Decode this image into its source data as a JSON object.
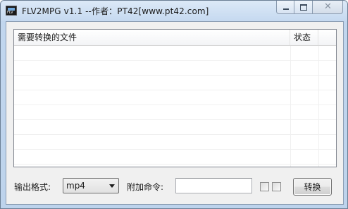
{
  "window": {
    "title": "FLV2MPG v1.1 --作者：PT42[www.pt42.com]"
  },
  "list": {
    "columns": [
      {
        "label": "需要转换的文件"
      },
      {
        "label": "状态"
      }
    ],
    "rows": []
  },
  "controls": {
    "format_label": "输出格式:",
    "format_value": "mp4",
    "command_label": "附加命令:",
    "command_value": "",
    "checkbox1_checked": false,
    "checkbox2_checked": false,
    "convert_label": "转换"
  }
}
